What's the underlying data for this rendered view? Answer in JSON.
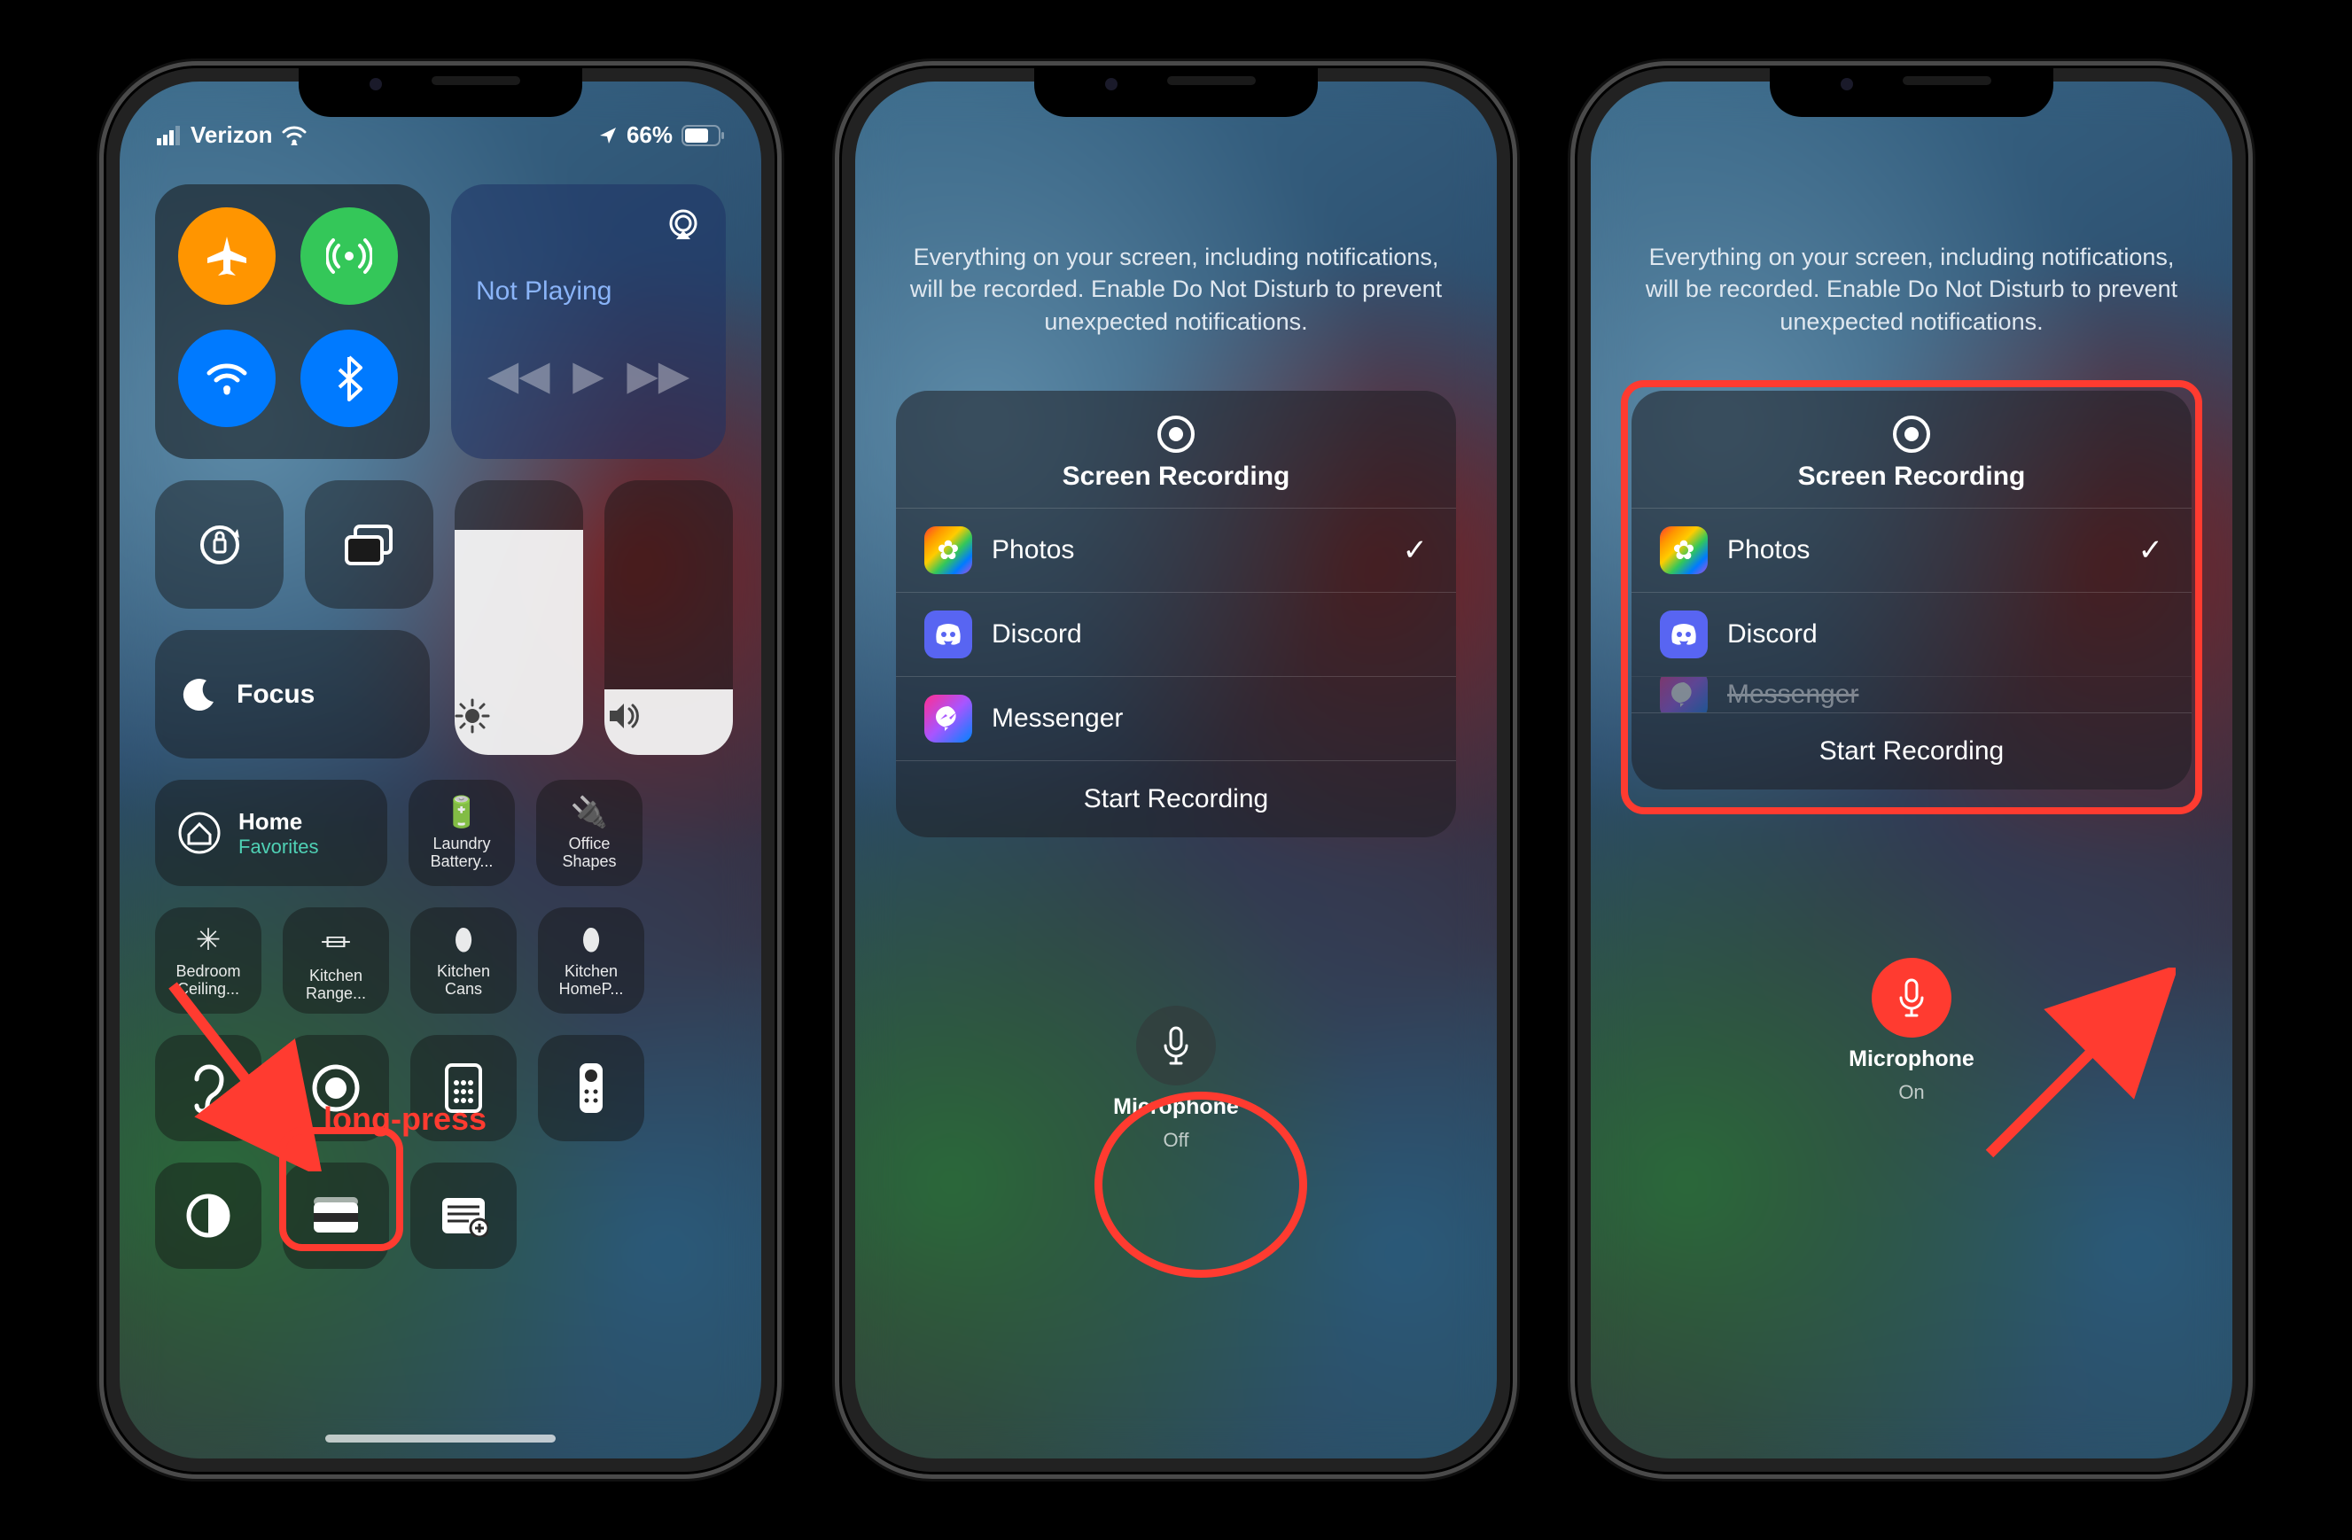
{
  "status": {
    "carrier": "Verizon",
    "battery": "66%"
  },
  "cc": {
    "not_playing": "Not Playing",
    "focus": "Focus",
    "home": {
      "title": "Home",
      "subtitle": "Favorites"
    },
    "devices": [
      {
        "label": "Laundry Battery..."
      },
      {
        "label": "Office Shapes"
      },
      {
        "label": "Bedroom Ceiling..."
      },
      {
        "label": "Kitchen Range..."
      },
      {
        "label": "Kitchen Cans"
      },
      {
        "label": "Kitchen HomeP..."
      }
    ]
  },
  "sr": {
    "info": "Everything on your screen, including notifications, will be recorded. Enable Do Not Disturb to prevent unexpected notifications.",
    "title": "Screen Recording",
    "apps": [
      {
        "name": "Photos",
        "selected": true
      },
      {
        "name": "Discord",
        "selected": false
      },
      {
        "name": "Messenger",
        "selected": false
      }
    ],
    "start": "Start Recording",
    "mic_label": "Microphone",
    "mic_off": "Off",
    "mic_on": "On"
  },
  "annotations": {
    "long_press": "long-press"
  }
}
